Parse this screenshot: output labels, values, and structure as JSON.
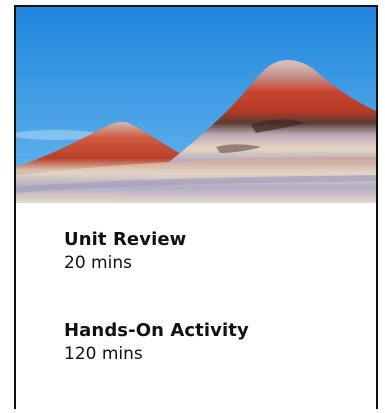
{
  "card": {
    "hero_image": "painted-hills-landscape",
    "items": [
      {
        "title": "Unit Review",
        "duration": "20 mins"
      },
      {
        "title": "Hands-On Activity",
        "duration": "120 mins"
      }
    ]
  },
  "colors": {
    "sky_top": "#1f86dd",
    "sky_bottom": "#63b4ee",
    "rock_red": "#c9462e",
    "rock_cream": "#e8d8c6",
    "rock_lavender": "#a9a4bf",
    "text": "#111111",
    "border": "#111111"
  }
}
